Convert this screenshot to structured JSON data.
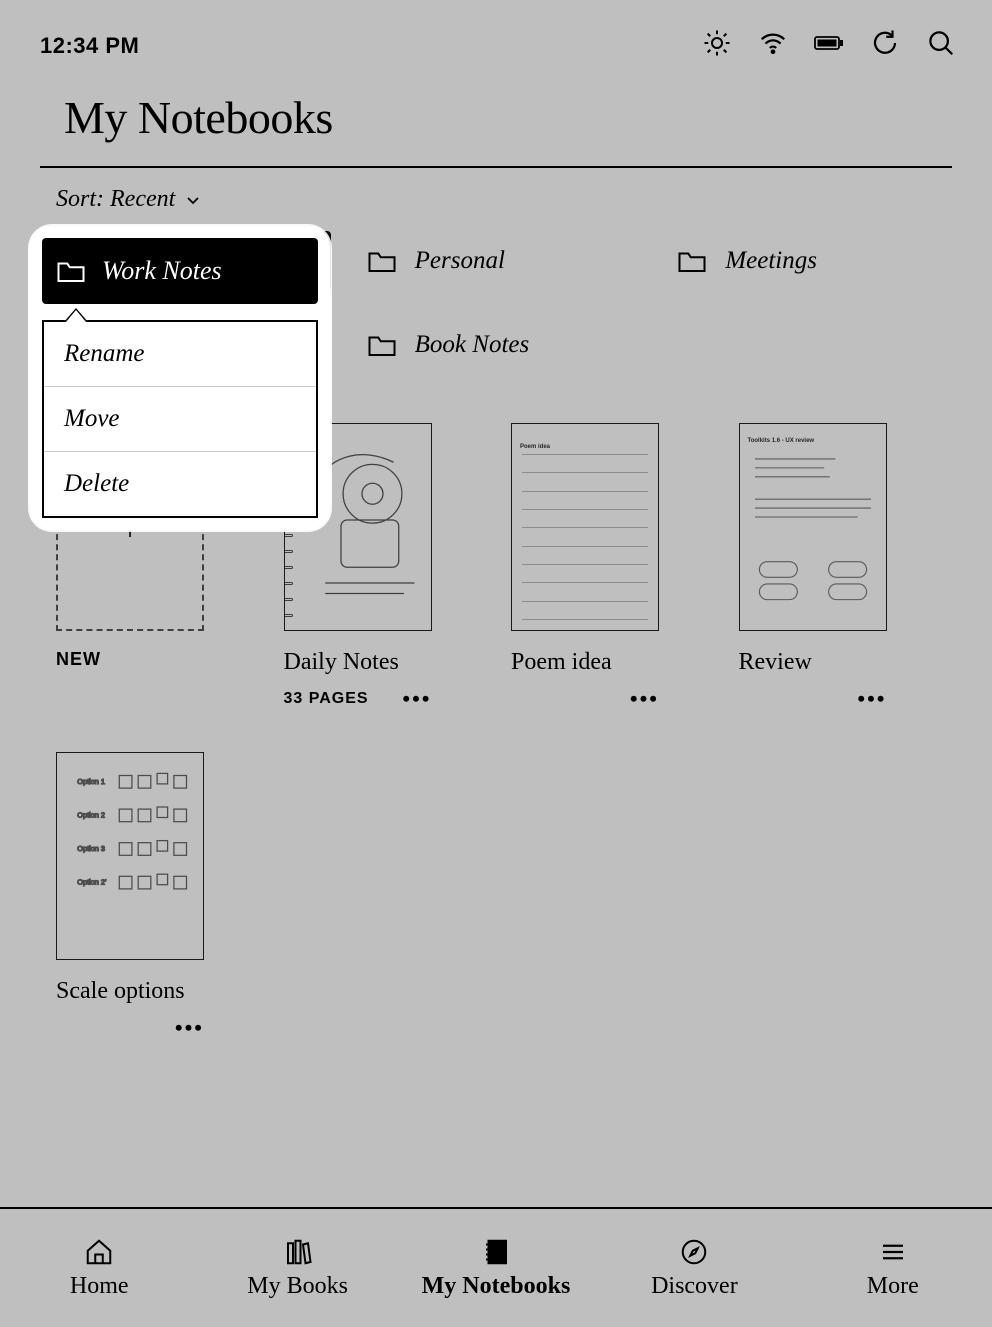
{
  "status": {
    "time": "12:34 PM"
  },
  "page": {
    "title": "My Notebooks"
  },
  "sort": {
    "label": "Sort: Recent"
  },
  "folders": [
    {
      "label": "Work Notes",
      "selected": true
    },
    {
      "label": "Personal",
      "selected": false
    },
    {
      "label": "Meetings",
      "selected": false
    },
    {
      "label": "Book Notes",
      "selected": false
    }
  ],
  "context_menu": {
    "target": "Work Notes",
    "items": [
      "Rename",
      "Move",
      "Delete"
    ]
  },
  "new_tile": {
    "label": "NEW"
  },
  "notebooks": [
    {
      "title": "Daily Notes",
      "pages": "33 PAGES",
      "art": "sketch"
    },
    {
      "title": "Poem idea",
      "pages": "",
      "art": "lined",
      "tiny": "Poem idea"
    },
    {
      "title": "Review",
      "pages": "",
      "art": "review",
      "tiny": "Toolkits 1.6 - UX review"
    },
    {
      "title": "Scale options",
      "pages": "",
      "art": "grid",
      "tiny": ""
    }
  ],
  "nav": {
    "items": [
      {
        "label": "Home"
      },
      {
        "label": "My Books"
      },
      {
        "label": "My Notebooks",
        "active": true
      },
      {
        "label": "Discover"
      },
      {
        "label": "More"
      }
    ]
  }
}
